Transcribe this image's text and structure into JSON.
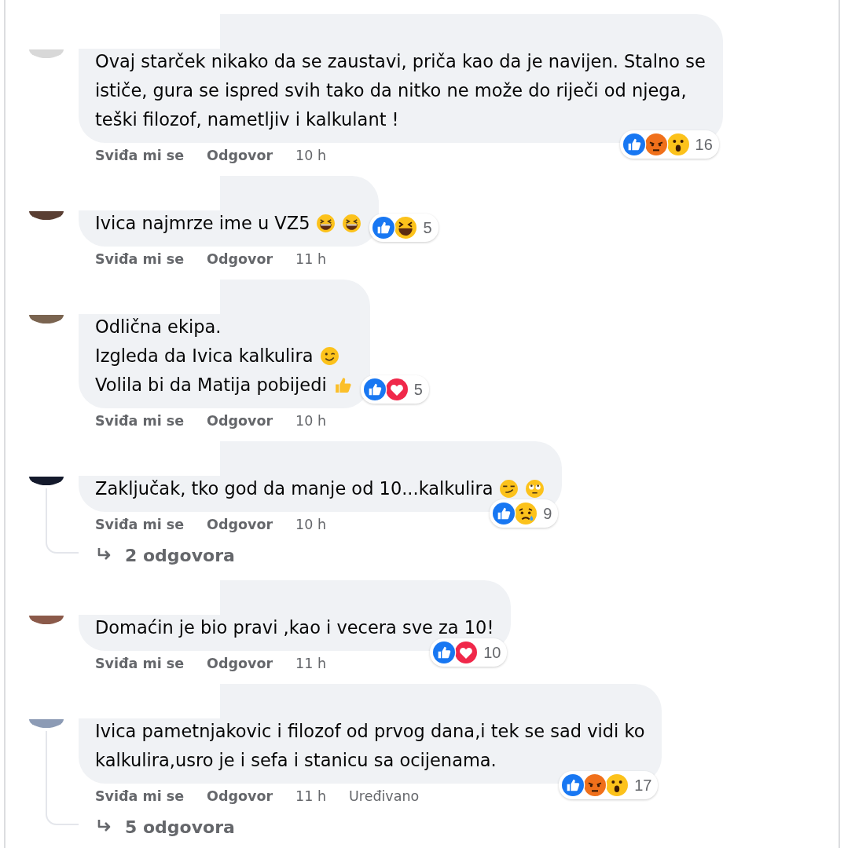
{
  "comments": [
    {
      "lines": [
        {
          "text": "Ovaj starček nikako da se zaustavi, priča kao da je navijen. Stalno se"
        },
        {
          "text": "ističe, gura se ispred svih tako da nitko ne može do riječi od njega,"
        },
        {
          "text": "teški filozof, nametljiv i kalkulant !"
        }
      ],
      "reactions": [
        {
          "kind": "like"
        },
        {
          "kind": "angry"
        },
        {
          "kind": "wow"
        }
      ],
      "reaction_count": "16",
      "reactions_beside": false,
      "like_label": "Sviđa mi se",
      "reply_label": "Odgovor",
      "time": "10 h"
    },
    {
      "lines": [
        {
          "text": "Ivica najmrze ime u VZ5",
          "emojis": [
            {
              "kind": "laughing"
            },
            {
              "kind": "laughing"
            }
          ]
        }
      ],
      "reactions": [
        {
          "kind": "like"
        },
        {
          "kind": "haha"
        }
      ],
      "reaction_count": "5",
      "reactions_beside": true,
      "like_label": "Sviđa mi se",
      "reply_label": "Odgovor",
      "time": "11 h"
    },
    {
      "lines": [
        {
          "text": "Odlična ekipa."
        },
        {
          "text": "Izgleda da Ivica kalkulira",
          "emojis": [
            {
              "kind": "wink"
            }
          ]
        },
        {
          "text": "Volila bi da Matija pobijedi",
          "emojis": [
            {
              "kind": "thumbs-up"
            }
          ]
        }
      ],
      "reactions": [
        {
          "kind": "like"
        },
        {
          "kind": "love"
        }
      ],
      "reaction_count": "5",
      "reactions_beside": true,
      "like_label": "Sviđa mi se",
      "reply_label": "Odgovor",
      "time": "10 h"
    },
    {
      "lines": [
        {
          "text": "Zaključak, tko god da manje od 10...kalkulira",
          "emojis": [
            {
              "kind": "smirk"
            },
            {
              "kind": "eye-roll"
            }
          ]
        }
      ],
      "reactions": [
        {
          "kind": "like"
        },
        {
          "kind": "sad"
        }
      ],
      "reaction_count": "9",
      "reactions_beside": false,
      "like_label": "Sviđa mi se",
      "reply_label": "Odgovor",
      "time": "10 h",
      "replies_label": "2 odgovora"
    },
    {
      "lines": [
        {
          "text": "Domaćin je bio pravi ,kao i vecera sve za 10!"
        }
      ],
      "reactions": [
        {
          "kind": "like"
        },
        {
          "kind": "love"
        }
      ],
      "reaction_count": "10",
      "reactions_beside": false,
      "like_label": "Sviđa mi se",
      "reply_label": "Odgovor",
      "time": "11 h"
    },
    {
      "lines": [
        {
          "text": "Ivica pametnjakovic i filozof od prvog dana,i tek se sad vidi ko"
        },
        {
          "text": "kalkulira,usro je i sefa i stanicu sa ocijenama."
        }
      ],
      "reactions": [
        {
          "kind": "like"
        },
        {
          "kind": "angry"
        },
        {
          "kind": "wow"
        }
      ],
      "reaction_count": "17",
      "reactions_beside": false,
      "like_label": "Sviđa mi se",
      "reply_label": "Odgovor",
      "time": "11 h",
      "edited": "Uređivano",
      "replies_label": "5 odgovora"
    }
  ]
}
